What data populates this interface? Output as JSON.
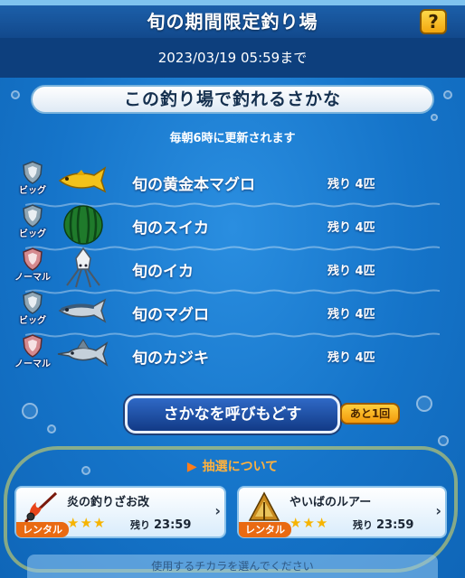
{
  "header": {
    "title": "旬の期間限定釣り場",
    "help_label": "?"
  },
  "period": {
    "deadline": "2023/03/19  05:59まで"
  },
  "section": {
    "title": "この釣り場で釣れるさかな",
    "update_note": "毎朝6時に更新されます"
  },
  "fish": [
    {
      "class": "ビッグ",
      "name": "旬の黄金本マグロ",
      "remaining": "残り 4匹",
      "icon": "golden-tuna-icon",
      "shield_color": "#8fa6b5"
    },
    {
      "class": "ビッグ",
      "name": "旬のスイカ",
      "remaining": "残り 4匹",
      "icon": "watermelon-icon",
      "shield_color": "#8fa6b5"
    },
    {
      "class": "ノーマル",
      "name": "旬のイカ",
      "remaining": "残り 4匹",
      "icon": "squid-icon",
      "shield_color": "#d58a8f"
    },
    {
      "class": "ビッグ",
      "name": "旬のマグロ",
      "remaining": "残り 4匹",
      "icon": "tuna-icon",
      "shield_color": "#8fa6b5"
    },
    {
      "class": "ノーマル",
      "name": "旬のカジキ",
      "remaining": "残り 4匹",
      "icon": "marlin-icon",
      "shield_color": "#d58a8f"
    }
  ],
  "recall": {
    "button_label": "さかなを呼びもどす",
    "remaining_label": "あと1回"
  },
  "lottery": {
    "label": "抽選について"
  },
  "rods": [
    {
      "name": "炎の釣りざお改",
      "rental_label": "レンタル",
      "stars": "★★★",
      "time_label": "残り",
      "time_value": "23:59",
      "icon": "flame-rod-icon"
    },
    {
      "name": "やいばのルアー",
      "rental_label": "レンタル",
      "stars": "★★★",
      "time_label": "残り",
      "time_value": "23:59",
      "icon": "blade-lure-icon"
    }
  ],
  "footer": {
    "prompt": "使用するチカラを選んでください"
  },
  "colors": {
    "header": "#1c5fa9",
    "sea": "#1574c9",
    "accent_orange": "#e96a12",
    "star": "#f6b400"
  }
}
